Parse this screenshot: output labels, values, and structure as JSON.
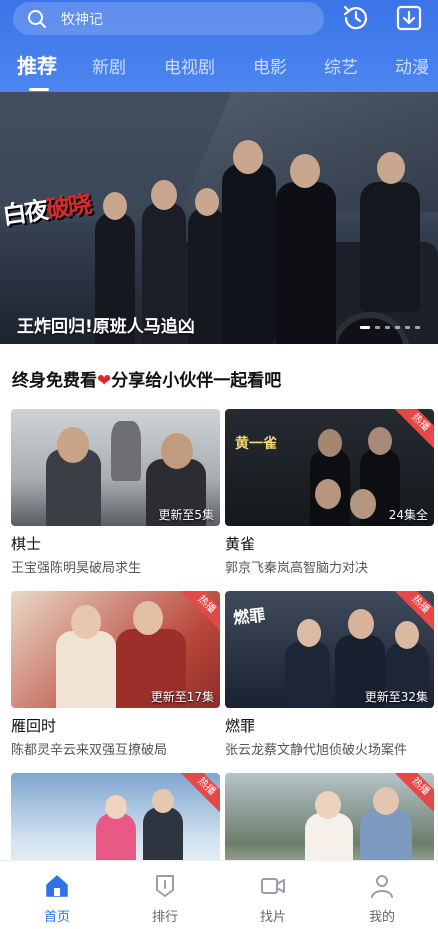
{
  "search": {
    "placeholder": "牧神记"
  },
  "tabs": [
    {
      "label": "推荐",
      "active": true
    },
    {
      "label": "新剧"
    },
    {
      "label": "电视剧"
    },
    {
      "label": "电影"
    },
    {
      "label": "综艺"
    },
    {
      "label": "动漫"
    }
  ],
  "banner": {
    "logo_text_white": "白夜",
    "logo_text_red": "破晓",
    "caption": "王炸回归!原班人马追凶",
    "dot_count": 6,
    "active_dot": 0
  },
  "section": {
    "title_pre": "终身免费看",
    "heart": "❤",
    "title_post": "分享给小伙伴一起看吧"
  },
  "cards": [
    {
      "title": "棋士",
      "desc": "王宝强陈明昊破局求生",
      "episode": "更新至5集",
      "hot": false
    },
    {
      "title": "黄雀",
      "desc": "郭京飞秦岚高智脑力对决",
      "episode": "24集全",
      "hot": true,
      "poster_text": "黄一雀"
    },
    {
      "title": "雁回时",
      "desc": "陈都灵辛云来双强互撩破局",
      "episode": "更新至17集",
      "hot": true
    },
    {
      "title": "燃罪",
      "desc": "张云龙蔡文静代旭侦破火场案件",
      "episode": "更新至32集",
      "hot": true,
      "poster_text": "燃罪"
    },
    {
      "title": "",
      "desc": "",
      "episode": "",
      "hot": true
    },
    {
      "title": "",
      "desc": "",
      "episode": "",
      "hot": true
    }
  ],
  "hot_label": "热播",
  "nav": [
    {
      "label": "首页",
      "icon": "home-icon",
      "active": true
    },
    {
      "label": "排行",
      "icon": "rank-icon"
    },
    {
      "label": "找片",
      "icon": "video-icon"
    },
    {
      "label": "我的",
      "icon": "profile-icon"
    }
  ],
  "colors": {
    "brand": "#3a74e8",
    "accent_active": "#2f72e6",
    "hot_ribbon": "#e64848",
    "heart": "#e0262b"
  }
}
